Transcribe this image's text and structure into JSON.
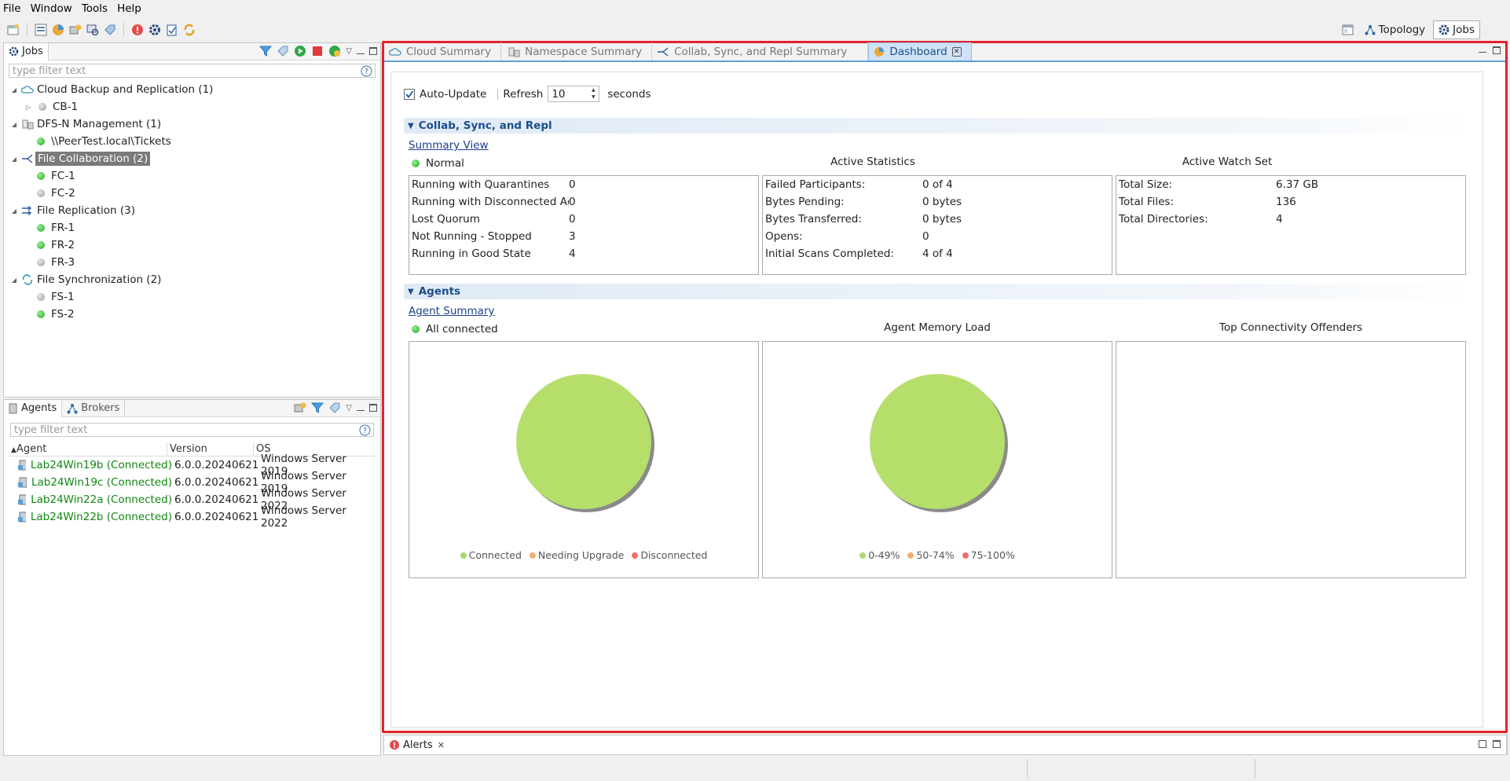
{
  "menu": [
    "File",
    "Window",
    "Tools",
    "Help"
  ],
  "perspectives": {
    "topology": "Topology",
    "jobs": "Jobs"
  },
  "jobs_view": {
    "title": "Jobs",
    "filter_placeholder": "type filter text",
    "tree": [
      {
        "label": "Cloud Backup and Replication (1)",
        "children": [
          {
            "label": "CB-1",
            "status": "gray",
            "expandable": true
          }
        ]
      },
      {
        "label": "DFS-N Management (1)",
        "children": [
          {
            "label": "\\\\PeerTest.local\\Tickets",
            "status": "green"
          }
        ]
      },
      {
        "label": "File Collaboration (2)",
        "selected": true,
        "children": [
          {
            "label": "FC-1",
            "status": "green"
          },
          {
            "label": "FC-2",
            "status": "gray"
          }
        ]
      },
      {
        "label": "File Replication (3)",
        "children": [
          {
            "label": "FR-1",
            "status": "green"
          },
          {
            "label": "FR-2",
            "status": "green"
          },
          {
            "label": "FR-3",
            "status": "gray"
          }
        ]
      },
      {
        "label": "File Synchronization (2)",
        "children": [
          {
            "label": "FS-1",
            "status": "gray"
          },
          {
            "label": "FS-2",
            "status": "green"
          }
        ]
      }
    ]
  },
  "agents_view": {
    "tabs": [
      "Agents",
      "Brokers"
    ],
    "filter_placeholder": "type filter text",
    "columns": [
      "Agent",
      "Version",
      "OS"
    ],
    "rows": [
      {
        "agent": "Lab24Win19b (Connected)",
        "version": "6.0.0.20240621",
        "os": "Windows Server 2019"
      },
      {
        "agent": "Lab24Win19c (Connected)",
        "version": "6.0.0.20240621",
        "os": "Windows Server 2019"
      },
      {
        "agent": "Lab24Win22a (Connected)",
        "version": "6.0.0.20240621",
        "os": "Windows Server 2022"
      },
      {
        "agent": "Lab24Win22b (Connected)",
        "version": "6.0.0.20240621",
        "os": "Windows Server 2022"
      }
    ]
  },
  "editor_tabs": [
    "Cloud Summary",
    "Namespace Summary",
    "Collab, Sync, and Repl Summary",
    "Dashboard"
  ],
  "dashboard": {
    "auto_update_label": "Auto-Update",
    "refresh_label": "Refresh",
    "refresh_value": "10",
    "seconds_label": "seconds",
    "collab": {
      "title": "Collab, Sync, and Repl",
      "link": "Summary View",
      "status": "Normal",
      "col2_title": "Active Statistics",
      "col3_title": "Active Watch Set",
      "states": [
        {
          "k": "Running with Quarantines",
          "v": "0"
        },
        {
          "k": "Running with Disconnected Agents",
          "v": "0"
        },
        {
          "k": "Lost Quorum",
          "v": "0"
        },
        {
          "k": "Not Running - Stopped",
          "v": "3"
        },
        {
          "k": "Running in Good State",
          "v": "4"
        }
      ],
      "stats": [
        {
          "k": "Failed Participants:",
          "v": "0 of 4"
        },
        {
          "k": "Bytes Pending:",
          "v": "0 bytes"
        },
        {
          "k": "Bytes Transferred:",
          "v": "0 bytes"
        },
        {
          "k": "Opens:",
          "v": "0"
        },
        {
          "k": "Initial Scans Completed:",
          "v": "4 of 4"
        }
      ],
      "watch": [
        {
          "k": "Total Size:",
          "v": "6.37 GB"
        },
        {
          "k": "Total Files:",
          "v": "136"
        },
        {
          "k": "Total Directories:",
          "v": "4"
        }
      ]
    },
    "agents": {
      "title": "Agents",
      "link": "Agent Summary",
      "status": "All connected",
      "col2_title": "Agent Memory Load",
      "col3_title": "Top Connectivity Offenders",
      "legend1": [
        {
          "label": "Connected",
          "color": "#a8d870"
        },
        {
          "label": "Needing Upgrade",
          "color": "#f0b070"
        },
        {
          "label": "Disconnected",
          "color": "#ee7070"
        }
      ],
      "legend2": [
        {
          "label": "0-49%",
          "color": "#a8d870"
        },
        {
          "label": "50-74%",
          "color": "#f0b070"
        },
        {
          "label": "75-100%",
          "color": "#ee7070"
        }
      ],
      "pie_color": "#b5df6a"
    }
  },
  "alerts_tab": "Alerts"
}
